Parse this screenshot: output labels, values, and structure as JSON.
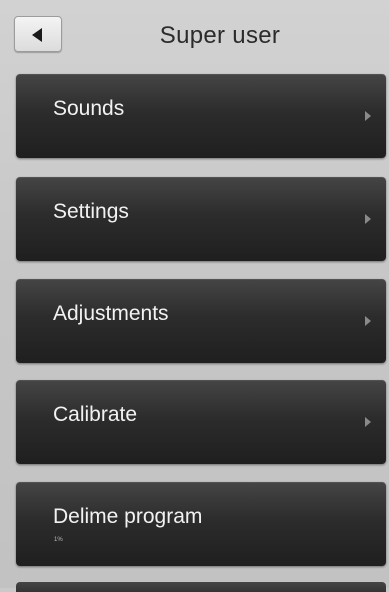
{
  "header": {
    "title": "Super user",
    "back_icon": "triangle-left-icon"
  },
  "menu": {
    "items": [
      {
        "label": "Sounds",
        "has_chevron": true
      },
      {
        "label": "Settings",
        "has_chevron": true
      },
      {
        "label": "Adjustments",
        "has_chevron": true
      },
      {
        "label": "Calibrate",
        "has_chevron": true
      },
      {
        "label": "Delime program",
        "subtext": "1%",
        "has_chevron": false
      }
    ]
  },
  "colors": {
    "background": "#c9c9c9",
    "item_background": "#2c2c2c",
    "item_text": "#f2f2f2",
    "title_text": "#2b2b2b"
  }
}
